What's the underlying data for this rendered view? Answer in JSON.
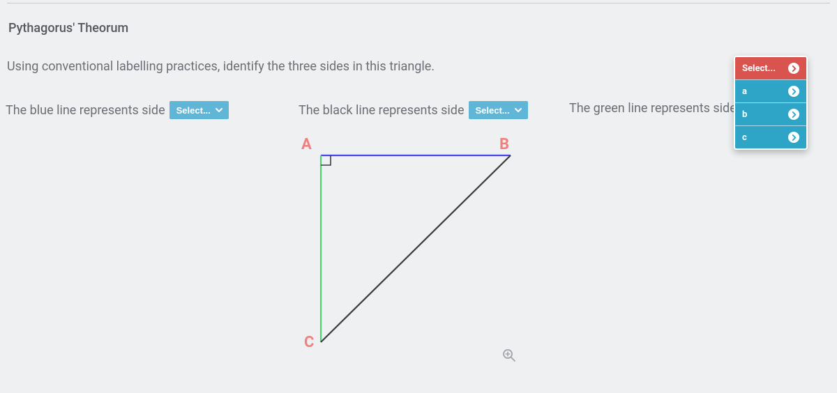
{
  "title": "Pythagorus' Theorum",
  "prompt": "Using conventional labelling practices, identify the three sides in this triangle.",
  "statements": {
    "blue": {
      "text": "The blue line represents side",
      "select_label": "Select..."
    },
    "black": {
      "text": "The black line represents side",
      "select_label": "Select..."
    },
    "green": {
      "text": "The green line represents side"
    }
  },
  "vertices": {
    "A": "A",
    "B": "B",
    "C": "C"
  },
  "dropdown": {
    "header": "Select...",
    "options": [
      "a",
      "b",
      "c"
    ]
  }
}
